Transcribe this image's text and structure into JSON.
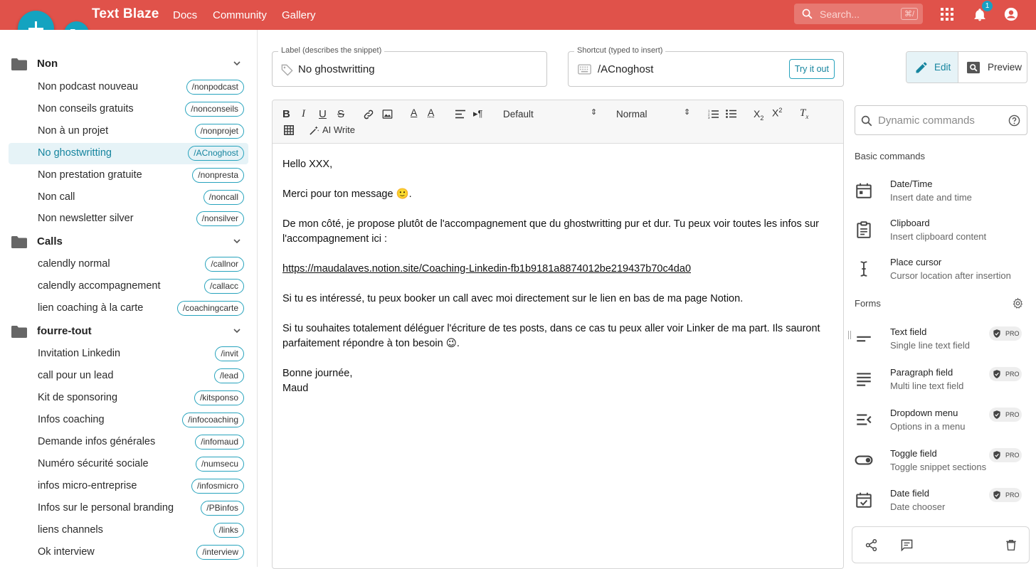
{
  "topbar": {
    "brand": "Text Blaze",
    "nav": [
      "Docs",
      "Community",
      "Gallery"
    ],
    "search_placeholder": "Search...",
    "search_shortcut": "⌘/",
    "notification_count": "1"
  },
  "sidebar": {
    "folders": [
      {
        "name": "Non",
        "snippets": [
          {
            "label": "Non podcast nouveau",
            "shortcut": "/nonpodcast"
          },
          {
            "label": "Non conseils gratuits",
            "shortcut": "/nonconseils"
          },
          {
            "label": "Non à un projet",
            "shortcut": "/nonprojet"
          },
          {
            "label": "No ghostwritting",
            "shortcut": "/ACnoghost"
          },
          {
            "label": "Non prestation gratuite",
            "shortcut": "/nonpresta"
          },
          {
            "label": "Non call",
            "shortcut": "/noncall"
          },
          {
            "label": "Non newsletter silver",
            "shortcut": "/nonsilver"
          }
        ]
      },
      {
        "name": "Calls",
        "snippets": [
          {
            "label": "calendly normal",
            "shortcut": "/callnor"
          },
          {
            "label": "calendly accompagnement",
            "shortcut": "/callacc"
          },
          {
            "label": "lien coaching à la carte",
            "shortcut": "/coachingcarte"
          }
        ]
      },
      {
        "name": "fourre-tout",
        "snippets": [
          {
            "label": "Invitation Linkedin",
            "shortcut": "/invit"
          },
          {
            "label": "call pour un lead",
            "shortcut": "/lead"
          },
          {
            "label": "Kit de sponsoring",
            "shortcut": "/kitsponso"
          },
          {
            "label": "Infos coaching",
            "shortcut": "/infocoaching"
          },
          {
            "label": "Demande infos générales",
            "shortcut": "/infomaud"
          },
          {
            "label": "Numéro sécurité sociale",
            "shortcut": "/numsecu"
          },
          {
            "label": "infos micro-entreprise",
            "shortcut": "/infosmicro"
          },
          {
            "label": "Infos sur le personal branding",
            "shortcut": "/PBinfos"
          },
          {
            "label": "liens channels",
            "shortcut": "/links"
          },
          {
            "label": "Ok interview",
            "shortcut": "/interview"
          }
        ]
      }
    ]
  },
  "snippet": {
    "label_legend": "Label (describes the snippet)",
    "label_value": "No ghostwritting",
    "shortcut_legend": "Shortcut (typed to insert)",
    "shortcut_value": "/ACnoghost",
    "try_out": "Try it out",
    "edit_label": "Edit",
    "preview_label": "Preview"
  },
  "toolbar": {
    "font_select": "Default",
    "size_select": "Normal",
    "ai_write": "AI Write"
  },
  "content": {
    "greeting": "Hello XXX,",
    "p1": "Merci pour ton message 🙂.",
    "p2": "De mon côté, je propose plutôt de l'accompagnement que du ghostwritting pur et dur. Tu peux voir toutes les infos sur l'accompagnement ici :",
    "link": "https://maudalaves.notion.site/Coaching-Linkedin-fb1b9181a8874012be219437b70c4da0",
    "p3": "Si tu es intéressé, tu peux booker un call avec moi directement sur le lien en bas de ma page Notion.",
    "p4": "Si tu souhaites totalement déléguer l'écriture de tes posts, dans ce cas tu peux aller voir Linker de ma part. Ils sauront parfaitement répondre à ton besoin 😉.",
    "closing1": "Bonne journée,",
    "closing2": "Maud"
  },
  "commands": {
    "search_placeholder": "Dynamic commands",
    "basic_title": "Basic commands",
    "basic": [
      {
        "title": "Date/Time",
        "sub": "Insert date and time",
        "icon": "calendar-icon"
      },
      {
        "title": "Clipboard",
        "sub": "Insert clipboard content",
        "icon": "clipboard-icon"
      },
      {
        "title": "Place cursor",
        "sub": "Cursor location after insertion",
        "icon": "text-cursor-icon"
      }
    ],
    "forms_title": "Forms",
    "pro_label": "PRO",
    "forms": [
      {
        "title": "Text field",
        "sub": "Single line text field",
        "icon": "short-text-icon"
      },
      {
        "title": "Paragraph field",
        "sub": "Multi line text field",
        "icon": "paragraph-icon"
      },
      {
        "title": "Dropdown menu",
        "sub": "Options in a menu",
        "icon": "dropdown-icon"
      },
      {
        "title": "Toggle field",
        "sub": "Toggle snippet sections",
        "icon": "toggle-icon"
      },
      {
        "title": "Date field",
        "sub": "Date chooser",
        "icon": "date-check-icon"
      }
    ]
  },
  "colors": {
    "brand": "#e0524a",
    "accent": "#14a3c0"
  }
}
